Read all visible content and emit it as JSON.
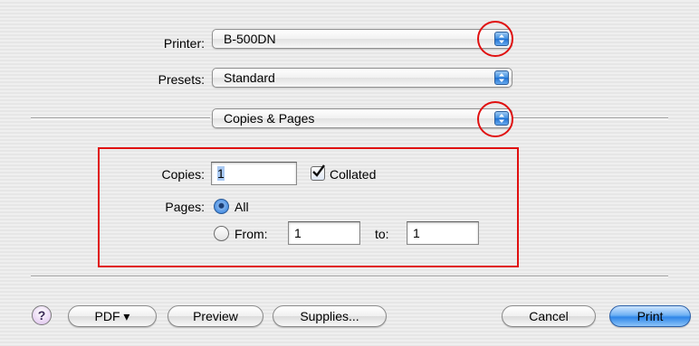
{
  "printer": {
    "label": "Printer:",
    "value": "B-500DN"
  },
  "presets": {
    "label": "Presets:",
    "value": "Standard"
  },
  "panel": {
    "value": "Copies & Pages"
  },
  "copies": {
    "label": "Copies:",
    "value": "1",
    "collated_label": "Collated",
    "collated_checked": true
  },
  "pages": {
    "label": "Pages:",
    "all_label": "All",
    "from_label": "From:",
    "from_value": "1",
    "to_label": "to:",
    "to_value": "1",
    "selected": "All"
  },
  "buttons": {
    "help": "?",
    "pdf": "PDF ▾",
    "preview": "Preview",
    "supplies": "Supplies...",
    "cancel": "Cancel",
    "print": "Print"
  },
  "colors": {
    "annotation": "#e01010",
    "accent": "#2f86e8"
  }
}
